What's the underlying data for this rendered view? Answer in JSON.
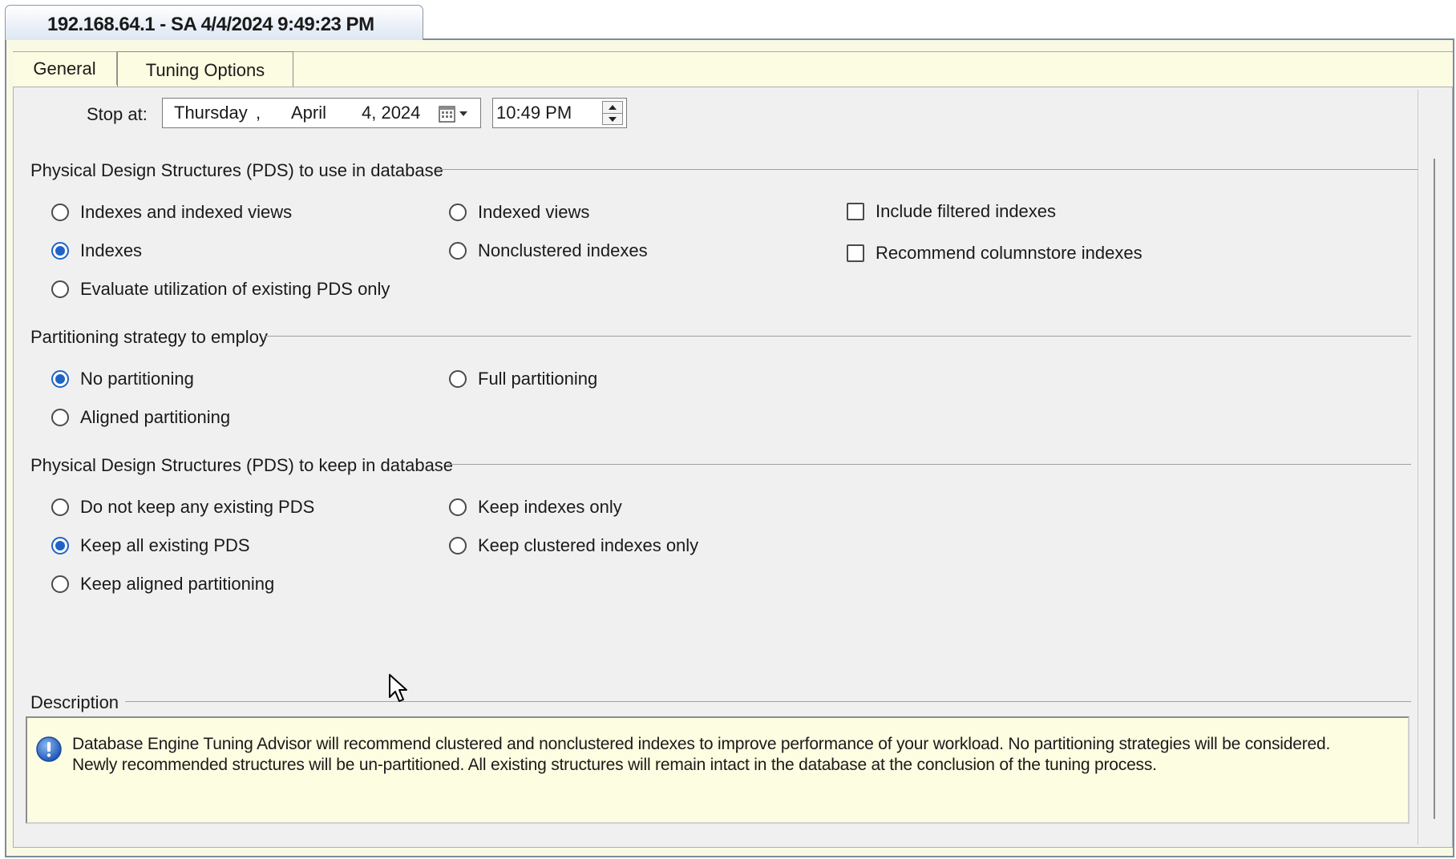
{
  "session": {
    "title": "192.168.64.1 - SA 4/4/2024 9:49:23 PM"
  },
  "tabs": [
    {
      "label": "General",
      "selected": false
    },
    {
      "label": "Tuning Options",
      "selected": true
    }
  ],
  "stop_at": {
    "label": "Stop at:",
    "day": "Thursday",
    "sep": ",",
    "month": "April",
    "date": "4, 2024",
    "time": "10:49 PM"
  },
  "pds_use": {
    "title": "Physical Design Structures (PDS) to use in database",
    "options": [
      {
        "label": "Indexes and indexed views",
        "checked": false
      },
      {
        "label": "Indexed views",
        "checked": false
      },
      {
        "label": "Indexes",
        "checked": true
      },
      {
        "label": "Nonclustered indexes",
        "checked": false
      },
      {
        "label": "Evaluate utilization of existing PDS only",
        "checked": false
      }
    ],
    "checkboxes": [
      {
        "label": "Include filtered indexes",
        "checked": false
      },
      {
        "label": "Recommend columnstore indexes",
        "checked": false
      }
    ]
  },
  "partitioning": {
    "title": "Partitioning strategy to employ",
    "options": [
      {
        "label": "No partitioning",
        "checked": true
      },
      {
        "label": "Full partitioning",
        "checked": false
      },
      {
        "label": "Aligned partitioning",
        "checked": false
      }
    ]
  },
  "pds_keep": {
    "title": "Physical Design Structures (PDS) to keep in database",
    "options": [
      {
        "label": "Do not keep any existing PDS",
        "checked": false
      },
      {
        "label": "Keep indexes only",
        "checked": false
      },
      {
        "label": "Keep all existing PDS",
        "checked": true
      },
      {
        "label": "Keep clustered indexes only",
        "checked": false
      },
      {
        "label": "Keep aligned partitioning",
        "checked": false
      }
    ]
  },
  "description": {
    "title": "Description",
    "line1": "Database Engine Tuning Advisor will recommend clustered and nonclustered indexes to improve performance of your workload. No partitioning strategies will be considered.",
    "line2": "Newly recommended structures will be un-partitioned. All existing structures will remain intact in the database at the conclusion of the tuning process."
  },
  "colors": {
    "accent": "#1f63c6",
    "panel": "#f0f0f0",
    "tabstrip": "#fcfce2"
  }
}
